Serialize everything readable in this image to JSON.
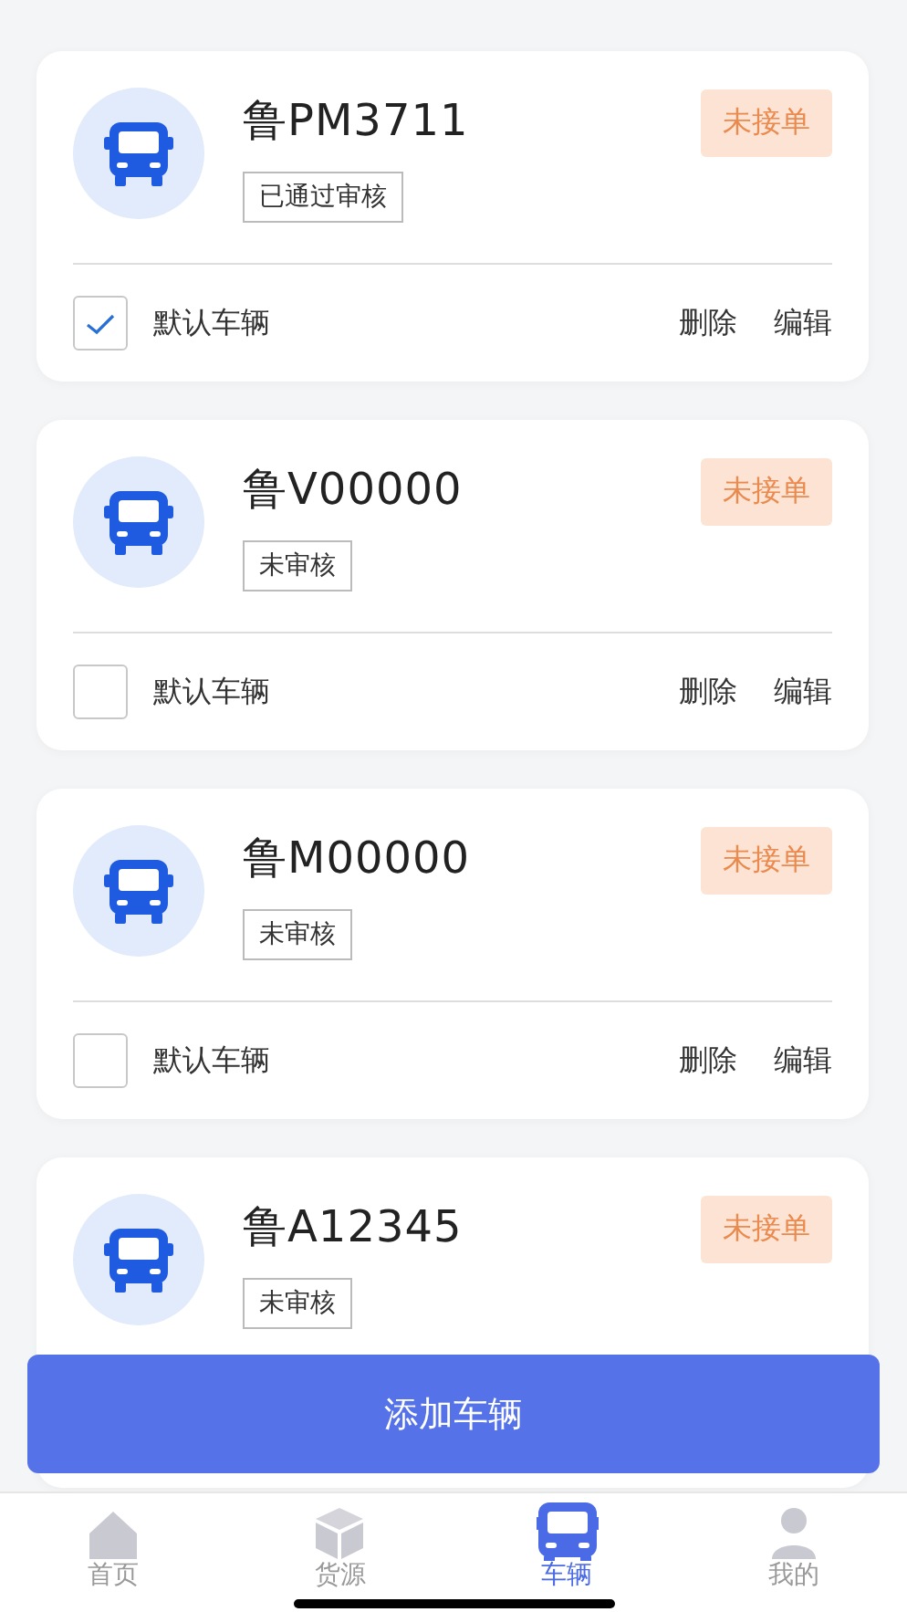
{
  "vehicles": [
    {
      "plate": "鲁PM3711",
      "review_status": "已通过审核",
      "order_status": "未接单",
      "default_checked": true,
      "default_label": "默认车辆",
      "delete": "删除",
      "edit": "编辑"
    },
    {
      "plate": "鲁V00000",
      "review_status": "未审核",
      "order_status": "未接单",
      "default_checked": false,
      "default_label": "默认车辆",
      "delete": "删除",
      "edit": "编辑"
    },
    {
      "plate": "鲁M00000",
      "review_status": "未审核",
      "order_status": "未接单",
      "default_checked": false,
      "default_label": "默认车辆",
      "delete": "删除",
      "edit": "编辑"
    },
    {
      "plate": "鲁A12345",
      "review_status": "未审核",
      "order_status": "未接单"
    }
  ],
  "add_button": "添加车辆",
  "tab_bar": [
    {
      "label": "首页",
      "selected": false
    },
    {
      "label": "货源",
      "selected": false
    },
    {
      "label": "车辆",
      "selected": true
    },
    {
      "label": "我的",
      "selected": false
    }
  ]
}
